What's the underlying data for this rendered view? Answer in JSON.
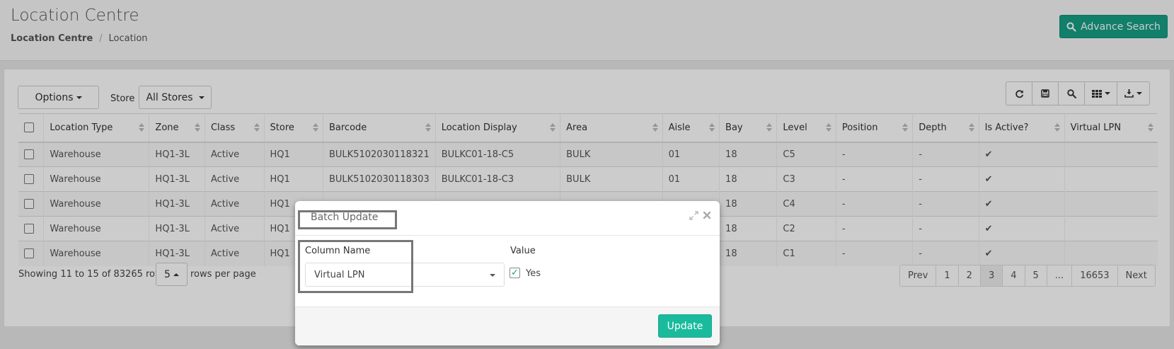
{
  "header": {
    "title": "Location Centre",
    "breadcrumb": [
      "Location Centre",
      "Location"
    ],
    "advance_search_label": "Advance Search"
  },
  "toolbar": {
    "options_label": "Options",
    "store_label": "Store",
    "store_value": "All Stores",
    "tools": [
      "refresh-icon",
      "save-icon",
      "search-icon",
      "columns-icon",
      "download-icon"
    ]
  },
  "table": {
    "columns": [
      "Location Type",
      "Zone",
      "Class",
      "Store",
      "Barcode",
      "Location Display",
      "Area",
      "Aisle",
      "Bay",
      "Level",
      "Position",
      "Depth",
      "Is Active?",
      "Virtual LPN"
    ],
    "rows": [
      [
        "Warehouse",
        "HQ1-3L",
        "Active",
        "HQ1",
        "BULK5102030118321",
        "BULKC01-18-C5",
        "BULK",
        "01",
        "18",
        "C5",
        "-",
        "-",
        "✔",
        ""
      ],
      [
        "Warehouse",
        "HQ1-3L",
        "Active",
        "HQ1",
        "BULK5102030118303",
        "BULKC01-18-C3",
        "BULK",
        "01",
        "18",
        "C3",
        "-",
        "-",
        "✔",
        ""
      ],
      [
        "Warehouse",
        "HQ1-3L",
        "Active",
        "HQ1",
        "",
        "",
        "",
        "",
        "18",
        "C4",
        "-",
        "-",
        "✔",
        ""
      ],
      [
        "Warehouse",
        "HQ1-3L",
        "Active",
        "HQ1",
        "",
        "",
        "",
        "",
        "18",
        "C2",
        "-",
        "-",
        "✔",
        ""
      ],
      [
        "Warehouse",
        "HQ1-3L",
        "Active",
        "HQ1",
        "",
        "",
        "",
        "",
        "18",
        "C1",
        "-",
        "-",
        "✔",
        ""
      ]
    ]
  },
  "footer": {
    "showing": "Showing 11 to 15 of 83265 rows",
    "page_size": "5",
    "rows_per_page": "rows per page",
    "pages": [
      "Prev",
      "1",
      "2",
      "3",
      "4",
      "5",
      "...",
      "16653",
      "Next"
    ],
    "active_page": "3"
  },
  "modal": {
    "title": "Batch Update",
    "column_name_label": "Column Name",
    "column_value": "Virtual LPN",
    "value_label": "Value",
    "checkbox_mark": "✓",
    "checkbox_label": "Yes",
    "update_label": "Update"
  },
  "colors": {
    "primary": "#169f85",
    "update": "#1abb9c"
  }
}
